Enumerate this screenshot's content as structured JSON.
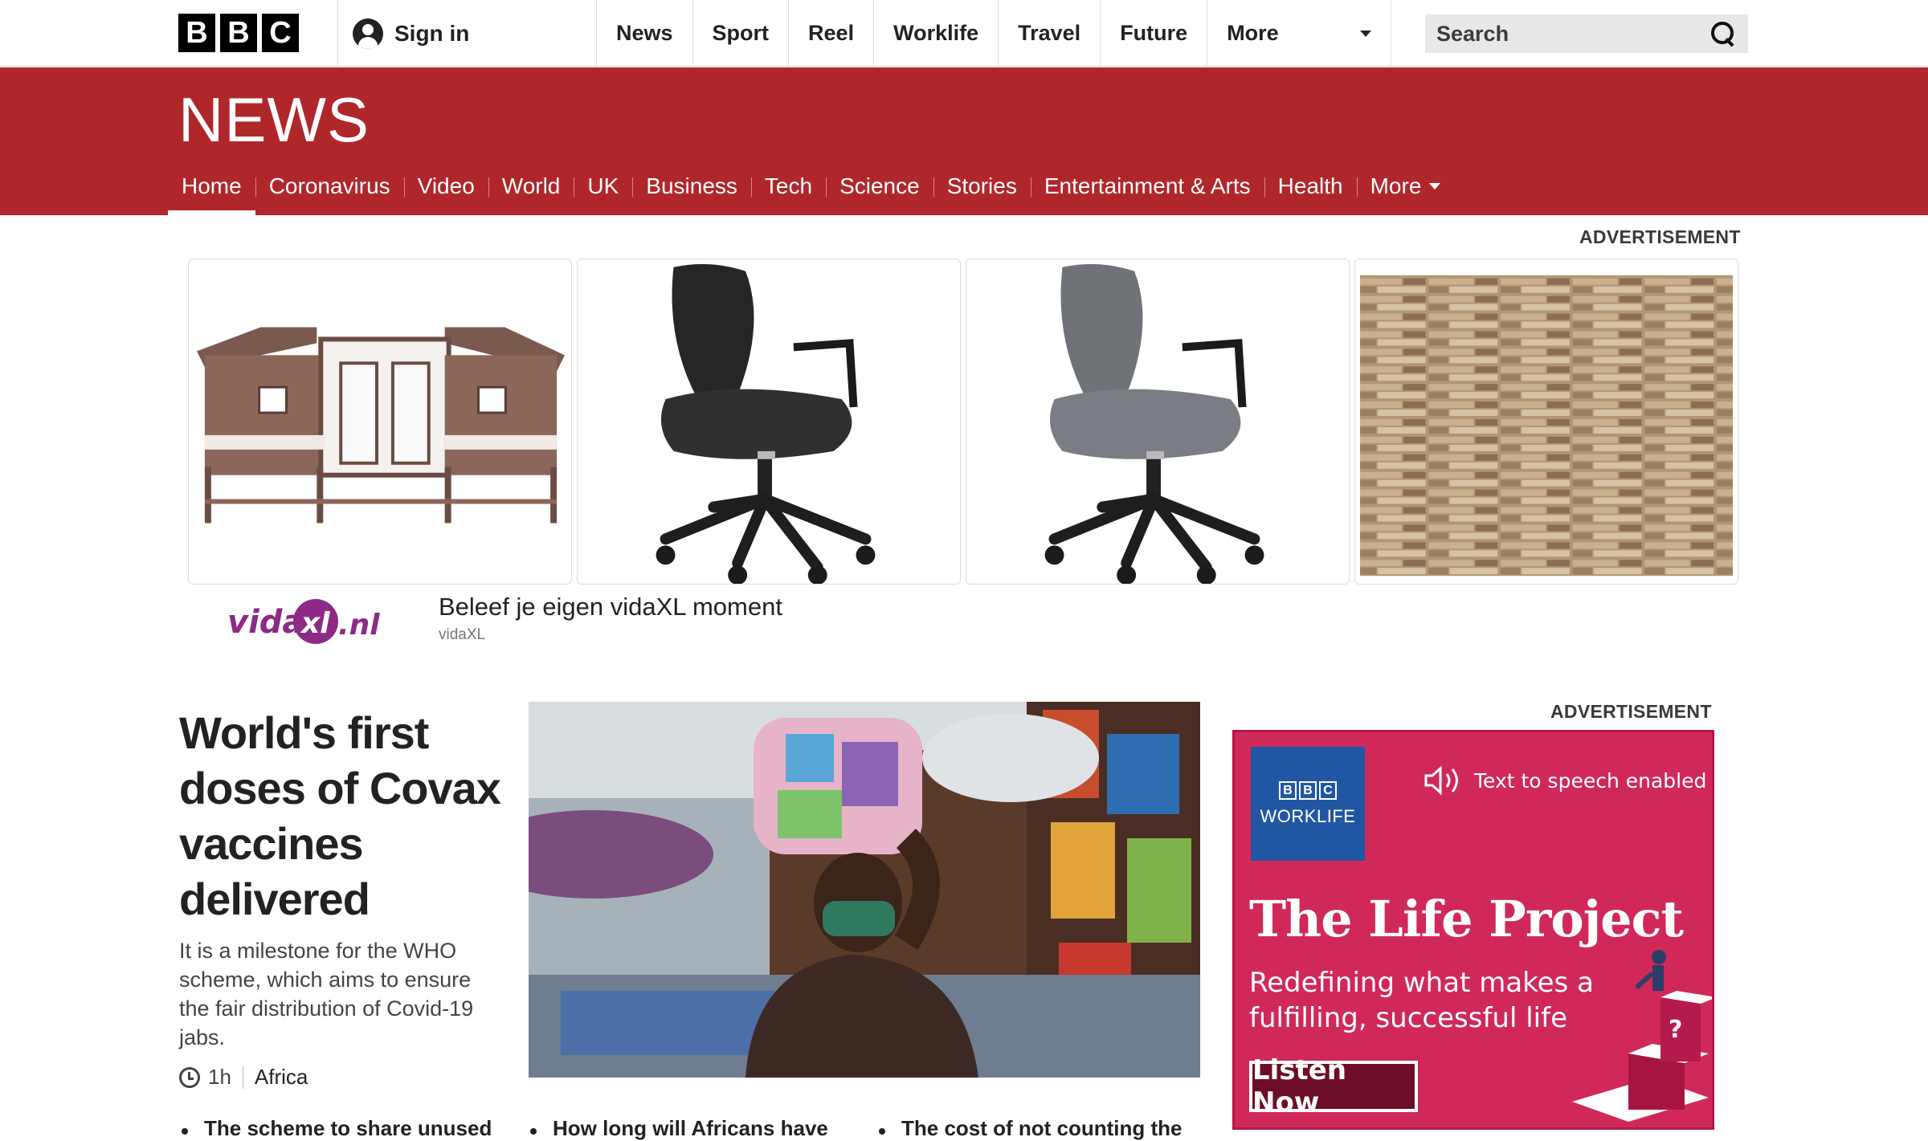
{
  "masthead": {
    "logo_letters": [
      "B",
      "B",
      "C"
    ],
    "sign_in": "Sign in",
    "nav": [
      "News",
      "Sport",
      "Reel",
      "Worklife",
      "Travel",
      "Future"
    ],
    "more": "More",
    "search_placeholder": "Search"
  },
  "news": {
    "logo": "NEWS",
    "subnav": [
      "Home",
      "Coronavirus",
      "Video",
      "World",
      "UK",
      "Business",
      "Tech",
      "Science",
      "Stories",
      "Entertainment & Arts",
      "Health"
    ],
    "active": "Home",
    "more": "More"
  },
  "top_ad": {
    "label": "ADVERTISEMENT",
    "products": [
      "rabbit-hutch",
      "black-office-chair",
      "grey-office-chair",
      "stone-wall-panel"
    ],
    "brand_logo": "vidaXL.nl",
    "title": "Beleef je eigen vidaXL moment",
    "source": "vidaXL"
  },
  "lead_story": {
    "headline": "World's first doses of Covax vaccines delivered",
    "summary": "It is a milestone for the WHO scheme, which aims to ensure the fair distribution of Covid-19 jabs.",
    "time": "1h",
    "tag": "Africa"
  },
  "related": [
    "The scheme to share unused",
    "How long will Africans have",
    "The cost of not counting the"
  ],
  "side_ad": {
    "label": "ADVERTISEMENT",
    "logo_letters": [
      "B",
      "B",
      "C"
    ],
    "logo_text": "WORKLIFE",
    "tts": "Text to speech enabled",
    "title": "The Life Project",
    "subtitle": "Redefining what makes a fulfilling, successful life",
    "cta": "Listen Now",
    "colors": {
      "background": "#d1285a",
      "logo_bg": "#2156a3",
      "button": "#6d0d27"
    }
  },
  "colors": {
    "news_red": "#b0272b"
  }
}
